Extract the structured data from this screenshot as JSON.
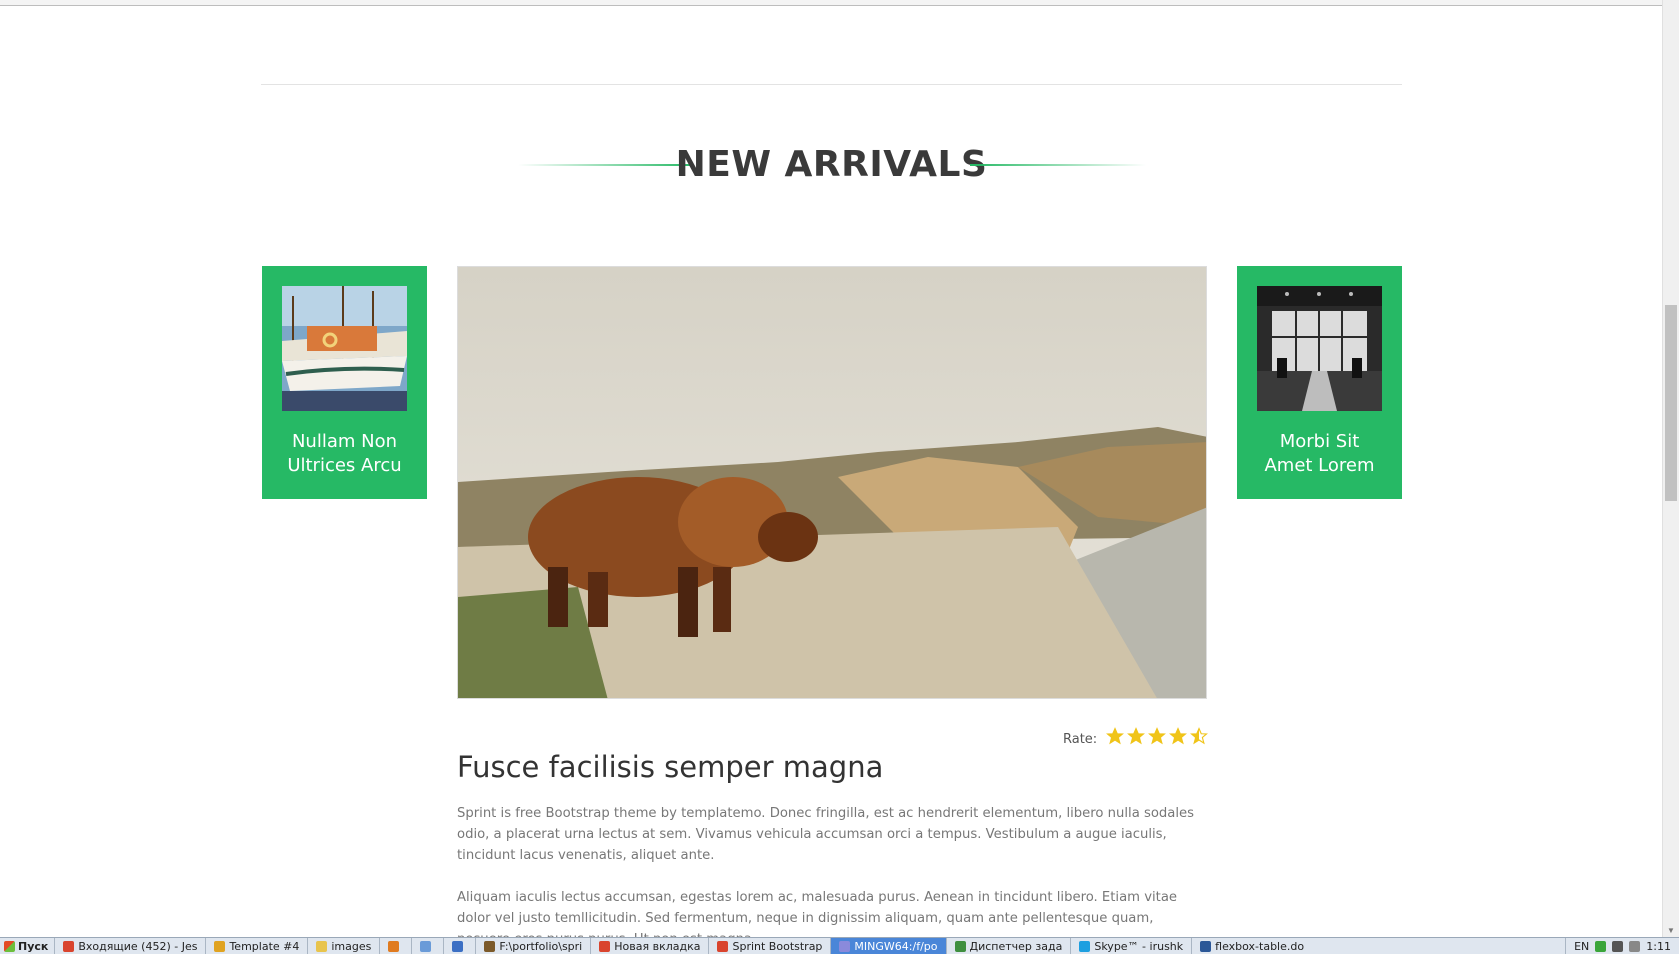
{
  "section": {
    "heading": "NEW ARRIVALS"
  },
  "side_cards": [
    {
      "title_line1": "Nullam Non",
      "title_line2": "Ultrices Arcu",
      "image": "boat-photo"
    },
    {
      "title_line1": "Morbi Sit",
      "title_line2": "Amet Lorem",
      "image": "cafe-interior-photo"
    }
  ],
  "main": {
    "image": "highland-cow-photo",
    "title": "Fusce facilisis semper magna",
    "rate_label": "Rate:",
    "rating": 4.5,
    "rating_max": 5,
    "paragraph1": "Sprint is free Bootstrap theme by templatemo. Donec fringilla, est ac hendrerit elementum, libero nulla sodales odio, a placerat urna lectus at sem. Vivamus vehicula accumsan orci a tempus. Vestibulum a augue iaculis, tincidunt lacus venenatis, aliquet ante.",
    "paragraph2": "Aliquam iaculis lectus accumsan, egestas lorem ac, malesuada purus. Aenean in tincidunt libero. Etiam vitae dolor vel justo temllicitudin. Sed fermentum, neque in dignissim aliquam, quam ante pellentesque quam, posuere eros purus purus. Ut non est magna."
  },
  "taskbar": {
    "start_label": "Пуск",
    "items": [
      {
        "label": "Входящие (452) - Jes",
        "icon_color": "#d9442e"
      },
      {
        "label": "Template #4",
        "icon_color": "#e0a321"
      },
      {
        "label": "images",
        "icon_color": "#e8c44d"
      },
      {
        "label": "",
        "icon_color": "#e07b1f"
      },
      {
        "label": "",
        "icon_color": "#6a9bd8"
      },
      {
        "label": "",
        "icon_color": "#3b6fc4"
      },
      {
        "label": "F:\\portfolio\\spri",
        "icon_color": "#7c5a2a"
      },
      {
        "label": "Новая вкладка",
        "icon_color": "#d9442e"
      },
      {
        "label": "Sprint Bootstrap",
        "icon_color": "#d9442e"
      },
      {
        "label": "MINGW64:/f/po",
        "icon_color": "#8a8adb",
        "active": true
      },
      {
        "label": "Диспетчер зада",
        "icon_color": "#3f8f3f"
      },
      {
        "label": "Skype™ - irushk",
        "icon_color": "#1d9fe0"
      },
      {
        "label": "flexbox-table.do",
        "icon_color": "#2b5797"
      }
    ],
    "lang": "EN",
    "clock": "1:11"
  },
  "colors": {
    "accent": "#26b965",
    "star": "#f0c419"
  }
}
